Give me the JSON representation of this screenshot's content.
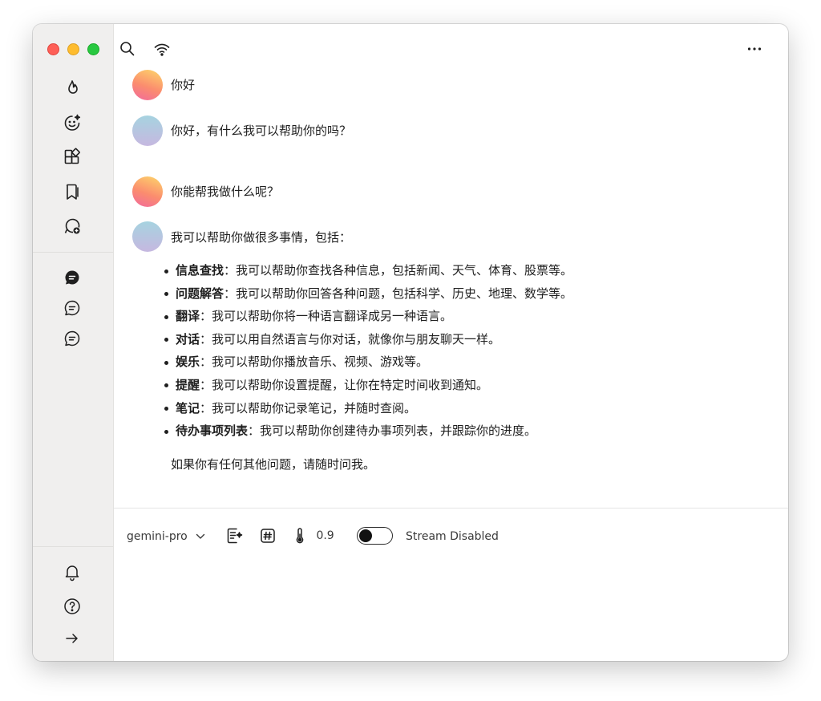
{
  "window": {
    "buttons": [
      "close",
      "minimize",
      "zoom"
    ]
  },
  "sidebar": {
    "top_icons": [
      "flame-icon",
      "smile-sparkle-icon",
      "widgets-icon",
      "bookmark-icon",
      "new-chat-icon"
    ],
    "chat_icons": [
      "chat-filled-icon",
      "chat-outline-icon",
      "chat-outline-icon"
    ],
    "bottom_icons": [
      "bell-icon",
      "help-icon",
      "arrow-right-icon"
    ]
  },
  "header": {
    "icons": [
      "search-icon",
      "wifi-icon",
      "more-icon"
    ]
  },
  "conversation": {
    "messages": [
      {
        "role": "user",
        "text": "你好"
      },
      {
        "role": "assistant",
        "text": "你好，有什么我可以帮助你的吗？"
      },
      {
        "role": "user",
        "text": "你能帮我做什么呢？"
      },
      {
        "role": "assistant",
        "text": "我可以帮助你做很多事情，包括："
      }
    ],
    "list": [
      {
        "term": "信息查找",
        "desc": "：我可以帮助你查找各种信息，包括新闻、天气、体育、股票等。"
      },
      {
        "term": "问题解答",
        "desc": "：我可以帮助你回答各种问题，包括科学、历史、地理、数学等。"
      },
      {
        "term": "翻译",
        "desc": "：我可以帮助你将一种语言翻译成另一种语言。"
      },
      {
        "term": "对话",
        "desc": "：我可以用自然语言与你对话，就像你与朋友聊天一样。"
      },
      {
        "term": "娱乐",
        "desc": "：我可以帮助你播放音乐、视频、游戏等。"
      },
      {
        "term": "提醒",
        "desc": "：我可以帮助你设置提醒，让你在特定时间收到通知。"
      },
      {
        "term": "笔记",
        "desc": "：我可以帮助你记录笔记，并随时查阅。"
      },
      {
        "term": "待办事项列表",
        "desc": "：我可以帮助你创建待办事项列表，并跟踪你的进度。"
      }
    ],
    "closing": "如果你有任何其他问题，请随时问我。"
  },
  "toolbar": {
    "model": "gemini-pro",
    "temperature": "0.9",
    "stream_label": "Stream Disabled",
    "stream_enabled": false
  },
  "colors": {
    "sidebar_bg": "#f0efee",
    "close": "#fe5f57",
    "minimize": "#febc2e",
    "zoom": "#28c840"
  }
}
